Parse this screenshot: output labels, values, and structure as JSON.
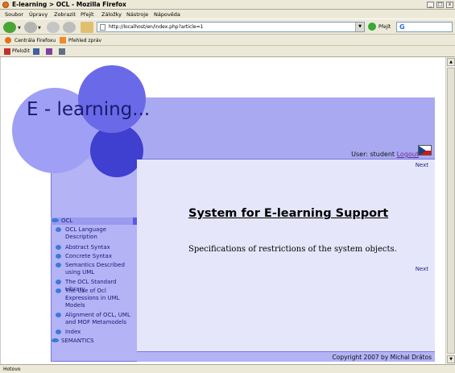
{
  "window": {
    "title": "E-learning > OCL - Mozilla Firefox",
    "minimize_glyph": "_",
    "maximize_glyph": "□",
    "close_glyph": "x"
  },
  "menu": [
    "Soubor",
    "Úpravy",
    "Zobrazit",
    "Přejít",
    "Záložky",
    "Nástroje",
    "Nápověda"
  ],
  "navigation": {
    "url": "http://localhost/en/index.php?article=1",
    "go_label": "Přejít",
    "search_engine_glyph": "G"
  },
  "bookmarks": [
    {
      "label": "Centrála Firefoxu",
      "icon": "firefox-icon"
    },
    {
      "label": "Přehled zpráv",
      "icon": "rss-icon"
    }
  ],
  "toolbar2": {
    "translate_label": "Přeložit"
  },
  "page": {
    "site_title": "E - learning...",
    "user_label": "User: student",
    "logout_label": "Logout",
    "next_label": "Next",
    "heading": "System for E-learning Support",
    "text": "Specifications of restrictions of the system objects.",
    "footer": "Copyright 2007 by Michal Drátos",
    "nav": [
      {
        "label": "OCL",
        "level": 0,
        "active": true
      },
      {
        "label": "OCL Language Description",
        "level": 1
      },
      {
        "label": "Abstract Syntax",
        "level": 1
      },
      {
        "label": "Concrete Syntax",
        "level": 1
      },
      {
        "label": "Semantics Described using UML",
        "level": 1
      },
      {
        "label": "The OCL Standard Library",
        "level": 1
      },
      {
        "label": "The Use of Ocl Expressions in UML Models",
        "level": 1
      },
      {
        "label": "Alignment of OCL, UML and MOF Metamodels",
        "level": 1
      },
      {
        "label": "Index",
        "level": 1
      },
      {
        "label": "SEMANTICS",
        "level": 0
      }
    ]
  },
  "status": {
    "text": "Hotovo"
  },
  "colors": {
    "frame": "#b3b3f6",
    "content_bg": "#e6e6fb",
    "circle_light": "#9f9ff5",
    "circle_mid": "#6a6ae8",
    "circle_dark": "#3f3fd0"
  }
}
